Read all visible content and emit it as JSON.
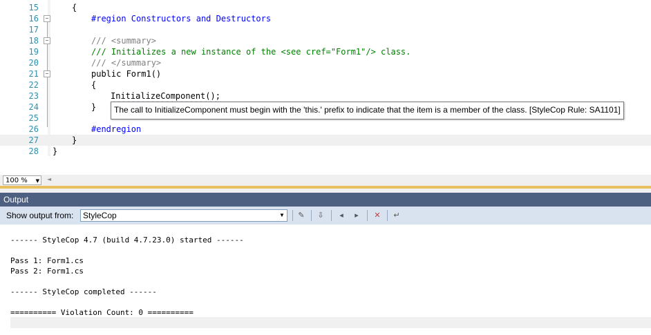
{
  "editor": {
    "lines": [
      {
        "num": "15",
        "text": "{",
        "type": "plain"
      },
      {
        "num": "16",
        "text": "#region Constructors and Destructors",
        "type": "keyword"
      },
      {
        "num": "17",
        "text": "",
        "type": "plain"
      },
      {
        "num": "18",
        "text": "/// <summary>",
        "type": "xml"
      },
      {
        "num": "19",
        "text": "/// Initializes a new instance of the <see cref=\"Form1\"/> class.",
        "type": "comment"
      },
      {
        "num": "20",
        "text": "/// </summary>",
        "type": "xml"
      },
      {
        "num": "21",
        "text": "public Form1()",
        "type": "decl"
      },
      {
        "num": "22",
        "text": "{",
        "type": "plain"
      },
      {
        "num": "23",
        "text": "InitializeComponent();",
        "type": "squiggle"
      },
      {
        "num": "24",
        "text": "}",
        "type": "plain"
      },
      {
        "num": "25",
        "text": "",
        "type": "plain"
      },
      {
        "num": "26",
        "text": "#endregion",
        "type": "keyword"
      },
      {
        "num": "27",
        "text": "}",
        "type": "plain"
      },
      {
        "num": "28",
        "text": "}",
        "type": "plain"
      }
    ],
    "tooltip": "The call to InitializeComponent must begin with the 'this.' prefix to indicate that the item is a member of the class. [StyleCop Rule: SA1101]",
    "zoom": "100 %"
  },
  "output": {
    "title": "Output",
    "show_from_label": "Show output from:",
    "source": "StyleCop",
    "lines": [
      "------ StyleCop 4.7 (build 4.7.23.0) started ------",
      "",
      "Pass 1: Form1.cs",
      "Pass 2: Form1.cs",
      "",
      "------ StyleCop completed ------",
      "",
      "========== Violation Count: 0 =========="
    ]
  }
}
